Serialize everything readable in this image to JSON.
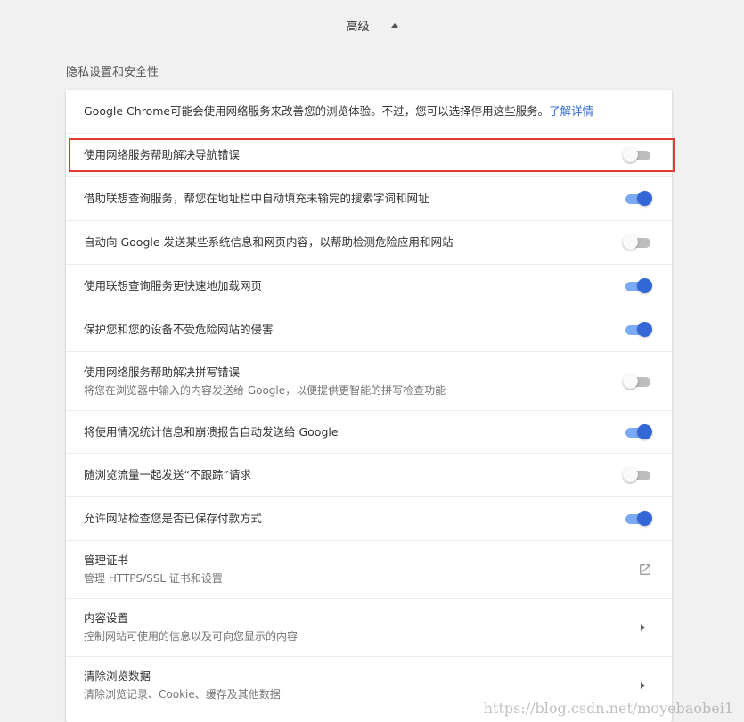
{
  "advanced": {
    "label": "高级",
    "arrow_icon": "triangle-up-icon"
  },
  "section": {
    "title": "隐私设置和安全性"
  },
  "intro": {
    "text": "Google Chrome可能会使用网络服务来改善您的浏览体验。不过，您可以选择停用这些服务。",
    "link": "了解详情"
  },
  "settings": [
    {
      "label": "使用网络服务帮助解决导航错误",
      "enabled": false
    },
    {
      "label": "借助联想查询服务，帮您在地址栏中自动填充未输完的搜索字词和网址",
      "enabled": true
    },
    {
      "label": "自动向 Google 发送某些系统信息和网页内容，以帮助检测危险应用和网站",
      "enabled": false
    },
    {
      "label": "使用联想查询服务更快速地加载网页",
      "enabled": true
    },
    {
      "label": "保护您和您的设备不受危险网站的侵害",
      "enabled": true
    },
    {
      "label": "使用网络服务帮助解决拼写错误",
      "sublabel": "将您在浏览器中输入的内容发送给 Google，以便提供更智能的拼写检查功能",
      "enabled": false
    },
    {
      "label": "将使用情况统计信息和崩溃报告自动发送给 Google",
      "enabled": true
    },
    {
      "label": "随浏览流量一起发送“不跟踪”请求",
      "enabled": false
    },
    {
      "label": "允许网站检查您是否已保存付款方式",
      "enabled": true
    }
  ],
  "links": [
    {
      "label": "管理证书",
      "sublabel": "管理 HTTPS/SSL 证书和设置",
      "icon": "open-in-new-icon"
    },
    {
      "label": "内容设置",
      "sublabel": "控制网站可使用的信息以及可向您显示的内容",
      "icon": "chevron-right-icon"
    },
    {
      "label": "清除浏览数据",
      "sublabel": "清除浏览记录、Cookie、缓存及其他数据",
      "icon": "chevron-right-icon"
    }
  ],
  "watermark": "https://blog.csdn.net/moyebaobei1",
  "colors": {
    "accent": "#3367d6",
    "accent_track": "#7baaf7",
    "highlight_box": "#e53935"
  }
}
